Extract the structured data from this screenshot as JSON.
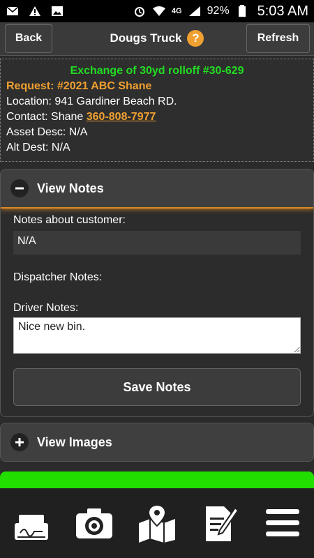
{
  "status_bar": {
    "left_icons": [
      "mail-icon",
      "warning-icon",
      "image-icon"
    ],
    "right_icons": [
      "alarm-icon",
      "wifi-icon",
      "signal-icon",
      "battery-icon"
    ],
    "network_label": "4G",
    "battery_percent": "92%",
    "time": "5:03 AM"
  },
  "header": {
    "back_label": "Back",
    "title": "Dougs Truck",
    "help_symbol": "?",
    "refresh_label": "Refresh"
  },
  "job": {
    "title": "Exchange of 30yd rolloff #30-629",
    "request": "Request: #2021 ABC Shane",
    "location": "Location: 941 Gardiner Beach RD.",
    "contact_prefix": "Contact: Shane",
    "contact_phone": "360-808-7977",
    "asset_desc": "Asset Desc: N/A",
    "alt_dest": "Alt Dest: N/A"
  },
  "notes": {
    "section_label": "View Notes",
    "customer_label": "Notes about customer:",
    "customer_value": "N/A",
    "dispatcher_label": "Dispatcher Notes:",
    "driver_label": "Driver Notes:",
    "driver_value": "Nice new bin.",
    "save_label": "Save Notes"
  },
  "images": {
    "section_label": "View Images"
  },
  "colors": {
    "title_green": "#22dd22",
    "accent_orange": "#f0a030",
    "bar_green": "#22dd00"
  },
  "bottom_nav": [
    "signature-icon",
    "camera-icon",
    "map-icon",
    "document-edit-icon",
    "menu-icon"
  ]
}
